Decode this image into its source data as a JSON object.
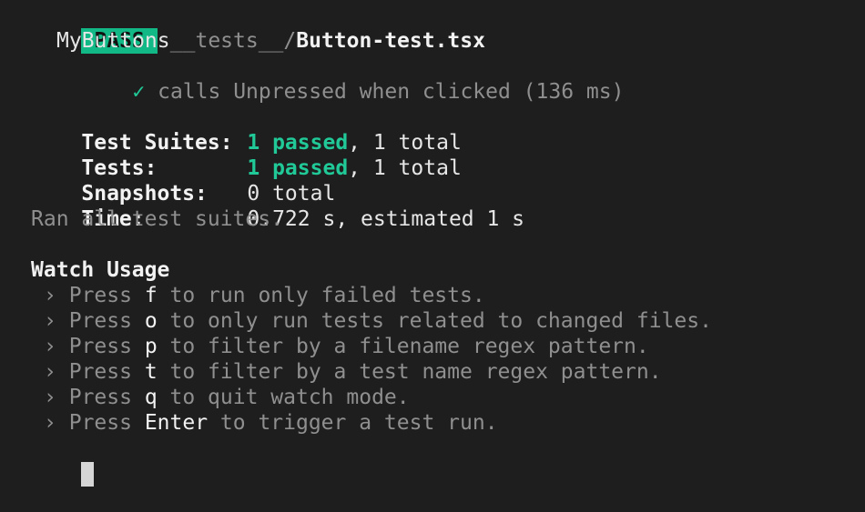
{
  "header": {
    "status_badge": "PASS",
    "path_dir": "__tests__/",
    "file_name": "Button-test.tsx"
  },
  "describe_block": {
    "name": "MyButtons",
    "test": {
      "check_mark": "✓",
      "label": "calls Unpressed when clicked (136 ms)"
    }
  },
  "summary": {
    "suites_label": "Test Suites:",
    "suites_passed": "1 passed",
    "suites_total": ", 1 total",
    "tests_label": "Tests:",
    "tests_passed": "1 passed",
    "tests_total": ", 1 total",
    "snapshots_label": "Snapshots:",
    "snapshots_value": "0 total",
    "time_label": "Time:",
    "time_value": "0.722 s, estimated 1 s",
    "ran_all": "Ran all test suites."
  },
  "watch_usage": {
    "title": "Watch Usage",
    "arrow": "›",
    "press_word": "Press ",
    "items": [
      {
        "key": "f",
        "text": " to run only failed tests."
      },
      {
        "key": "o",
        "text": " to only run tests related to changed files."
      },
      {
        "key": "p",
        "text": " to filter by a filename regex pattern."
      },
      {
        "key": "t",
        "text": " to filter by a test name regex pattern."
      },
      {
        "key": "q",
        "text": " to quit watch mode."
      },
      {
        "key": "Enter",
        "text": " to trigger a test run."
      }
    ]
  },
  "colors": {
    "background": "#1e1e1e",
    "pass_badge": "#12b886",
    "passed_text": "#20c997",
    "dim_text": "#8f8f8f"
  }
}
